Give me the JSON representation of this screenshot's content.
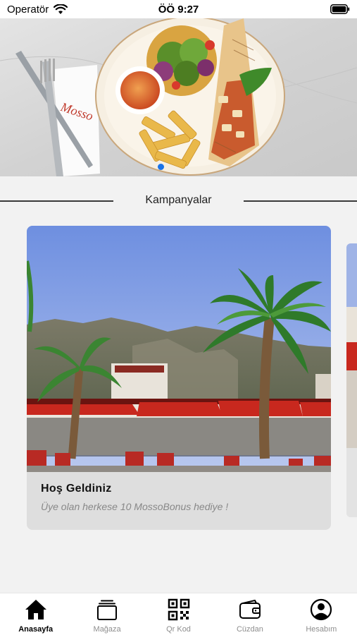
{
  "status_bar": {
    "carrier": "Operatör",
    "time": "ÖÖ 9:27"
  },
  "hero": {
    "image_icon": "food-plate-photo",
    "active_page": 1
  },
  "section": {
    "title": "Kampanyalar"
  },
  "campaign": {
    "title": "Hoş Geldiniz",
    "description": "Üye olan herkese 10 MossoBonus hediye !",
    "image_icon": "restaurant-terrace-photo"
  },
  "tab_bar": {
    "items": [
      {
        "label": "Anasayfa",
        "icon": "home-icon",
        "active": true
      },
      {
        "label": "Mağaza",
        "icon": "store-icon",
        "active": false
      },
      {
        "label": "Qr Kod",
        "icon": "qr-code-icon",
        "active": false
      },
      {
        "label": "Cüzdan",
        "icon": "wallet-icon",
        "active": false
      },
      {
        "label": "Hesabım",
        "icon": "account-icon",
        "active": false
      }
    ]
  },
  "colors": {
    "accent": "#1a73e8",
    "background": "#f2f2f2",
    "card_background": "#dedede",
    "awning_red": "#c8281e"
  }
}
